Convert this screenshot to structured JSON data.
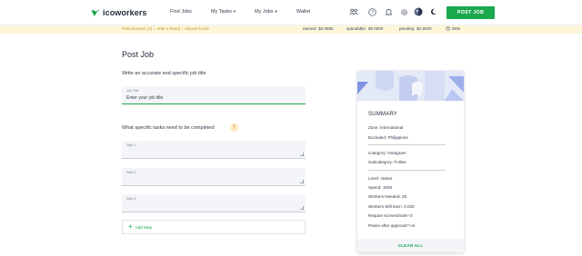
{
  "brand": {
    "name": "icoworkers",
    "accent": "#19a84b"
  },
  "nav": {
    "find_jobs": "Find Jobs",
    "my_tasks": "My Tasks",
    "my_jobs": "My Jobs",
    "wallet": "Wallet",
    "post_job": "POST JOB",
    "icons": [
      "team-icon",
      "help-icon",
      "bell-icon",
      "settings-icon",
      "avatar",
      "dark-mode-icon"
    ]
  },
  "notice": {
    "paid_surveys": "Paid Surveys (2)",
    "refer": "refer a friend",
    "deposit": "deposit funds",
    "earned_label": "earned:",
    "earned_value": "$4.0655",
    "spendable_label": "spendable:",
    "spendable_value": "$0.0000",
    "pending_label": "pending:",
    "pending_value": "$1.8020",
    "time": "250s"
  },
  "form": {
    "page_title": "Post Job",
    "title_prompt": "Write an accurate and specific job title",
    "title_field_label": "Job Title",
    "title_field_placeholder": "Enter your job title",
    "tasks_prompt": "What specific tasks need to be completed",
    "steps": [
      "Step 1",
      "Step 2",
      "Step 3"
    ],
    "add_step": "Add Step"
  },
  "summary": {
    "title": "SUMMARY",
    "zone": "Zone: International",
    "excluded": "Excluded: Philippines",
    "category": "Category: Instagram",
    "subcategory": "Subcategory: Follow",
    "level": "Level: starter",
    "speed": "Speed: 1000",
    "workers_needed": "Workers Needed: 25",
    "workers_earn": "Workers Will Earn: 0.020",
    "screenshots": "Require screenshots? 0",
    "pause": "Pause after approval? no",
    "clear_all": "CLEAR ALL"
  }
}
